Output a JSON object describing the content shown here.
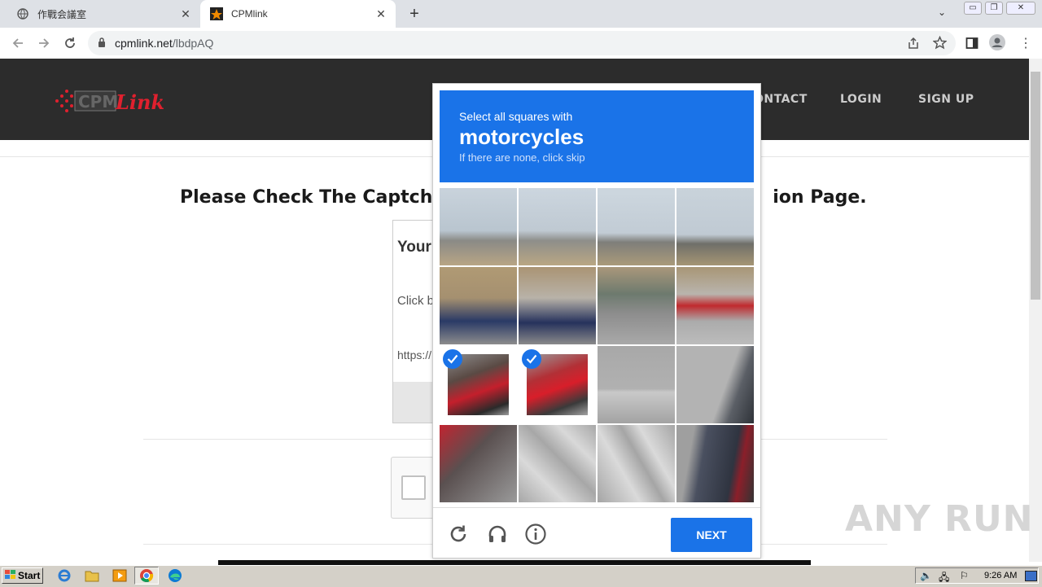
{
  "browser": {
    "tabs": [
      {
        "title": "作戰会議室",
        "active": false
      },
      {
        "title": "CPMlink",
        "active": true
      }
    ],
    "url_host": "cpmlink.net",
    "url_path": "/lbdpAQ"
  },
  "site": {
    "logo_text": "CPMLink",
    "nav": [
      "ONTACT",
      "LOGIN",
      "SIGN UP"
    ],
    "heading_left": "Please Check The Captcha",
    "heading_right": "ion Page.",
    "box_title_partial": "Your",
    "box_line1_partial": "Click b",
    "box_line2_partial": "https://"
  },
  "challenge": {
    "instruction": "Select all squares with",
    "target": "motorcycles",
    "hint": "If there are none, click skip",
    "selected_cells": [
      8,
      9
    ],
    "next_label": "NEXT"
  },
  "watermark": "ANY RUN",
  "taskbar": {
    "start_label": "Start",
    "clock": "9:26 AM"
  },
  "colors": {
    "accent": "#1a73e8",
    "site_header": "#2c2c2c",
    "logo_red": "#e0202e"
  }
}
